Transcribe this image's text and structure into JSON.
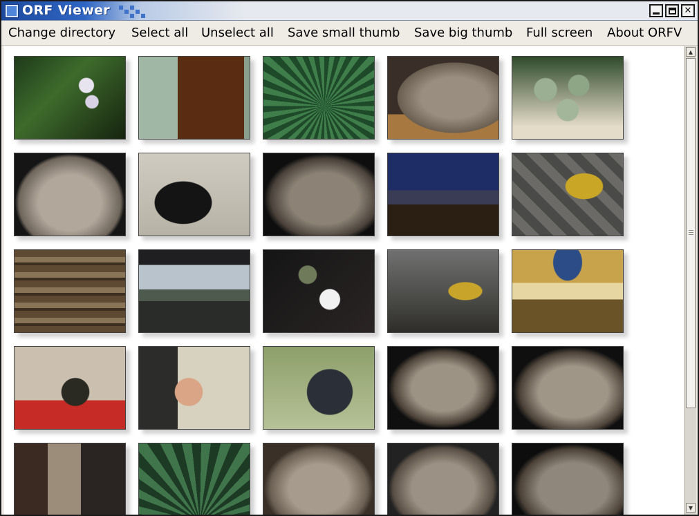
{
  "window": {
    "title": "ORF Viewer"
  },
  "menu": {
    "items": [
      "Change directory",
      "Select all",
      "Unselect all",
      "Save small thumb",
      "Save big thumb",
      "Full screen",
      "About ORFV"
    ]
  },
  "thumbnails": [
    [
      "orchid plant",
      "escalator poster woman",
      "green agave plant",
      "grey cat lying",
      "cactus plant"
    ],
    [
      "fluffy grey cat",
      "man in tuxedo",
      "grey cat",
      "city street at dusk",
      "yellow leaf on cobbles"
    ],
    [
      "palm tree trunk",
      "glass corridor",
      "white orchid",
      "leaf on paving",
      "mall glass dome"
    ],
    [
      "witch figure in mall",
      "witch figure closeup",
      "iron bench detail",
      "sleepy grey cat",
      "sleepy grey cat"
    ],
    [
      "mall interior railings",
      "palm leaf",
      "grey cat closeup",
      "grey cat lying",
      "grey cat"
    ]
  ],
  "colors": {
    "titlebar_accent": "#2f66c4",
    "window_bg": "#efece6",
    "content_bg": "#ffffff"
  }
}
